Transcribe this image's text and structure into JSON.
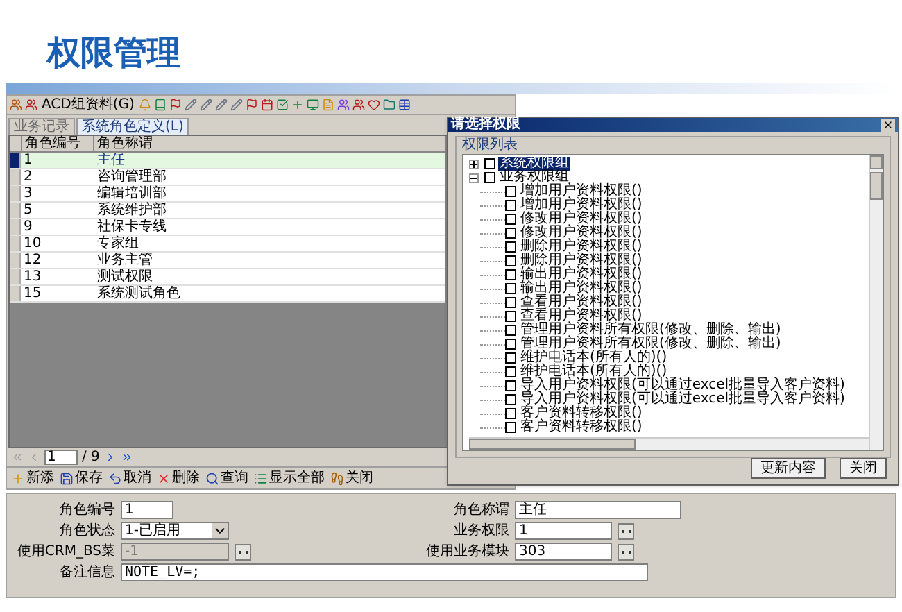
{
  "page_title": "权限管理",
  "toolbar": {
    "label_button": "ACD组资料(G)"
  },
  "tabs": [
    {
      "label": "业务记录",
      "selected": false
    },
    {
      "label": "系统角色定义(L)",
      "selected": true
    }
  ],
  "table": {
    "columns": [
      "角色编号",
      "角色称谓"
    ],
    "rows": [
      {
        "cells": [
          "1",
          "主任"
        ],
        "selected": true
      },
      {
        "cells": [
          "2",
          "咨询管理部"
        ],
        "selected": false
      },
      {
        "cells": [
          "3",
          "编辑培训部"
        ],
        "selected": false
      },
      {
        "cells": [
          "5",
          "系统维护部"
        ],
        "selected": false
      },
      {
        "cells": [
          "9",
          "社保卡专线"
        ],
        "selected": false
      },
      {
        "cells": [
          "10",
          "专家组"
        ],
        "selected": false
      },
      {
        "cells": [
          "12",
          "业务主管"
        ],
        "selected": false
      },
      {
        "cells": [
          "13",
          "测试权限"
        ],
        "selected": false
      },
      {
        "cells": [
          "15",
          "系统测试角色"
        ],
        "selected": false
      }
    ]
  },
  "pager": {
    "page": "1",
    "total": "/ 9"
  },
  "actions": [
    {
      "label": "新添",
      "kind": "add"
    },
    {
      "label": "保存",
      "kind": "save"
    },
    {
      "label": "取消",
      "kind": "undo"
    },
    {
      "label": "删除",
      "kind": "delete"
    },
    {
      "label": "查询",
      "kind": "search"
    },
    {
      "label": "显示全部",
      "kind": "all"
    },
    {
      "label": "关闭",
      "kind": "close"
    }
  ],
  "form": {
    "left": [
      {
        "label": "角色编号",
        "value": "1",
        "kind": "text",
        "disabled": false
      },
      {
        "label": "角色状态",
        "value": "1-已启用",
        "kind": "select",
        "disabled": false
      },
      {
        "label": "使用CRM_BS菜",
        "value": "-1",
        "kind": "lookup",
        "disabled": true
      }
    ],
    "right": [
      {
        "label": "角色称谓",
        "value": "主任",
        "kind": "text",
        "disabled": false
      },
      {
        "label": "业务权限",
        "value": "1",
        "kind": "lookup",
        "disabled": false
      },
      {
        "label": "使用业务模块",
        "value": "303",
        "kind": "lookup",
        "disabled": false
      }
    ],
    "note": {
      "label": "备注信息",
      "value": "NOTE_LV=;"
    }
  },
  "dialog": {
    "title": "请选择权限",
    "group": "权限列表",
    "tree": [
      {
        "label": "系统权限组",
        "checked": false,
        "expanded": false,
        "selected": true
      },
      {
        "label": "业务权限组",
        "checked": false,
        "expanded": true,
        "selected": false,
        "children": [
          {
            "label": "增加用户资料权限()",
            "checked": false,
            "selected": false
          },
          {
            "label": "增加用户资料权限()",
            "checked": false,
            "selected": false
          },
          {
            "label": "修改用户资料权限()",
            "checked": false,
            "selected": false
          },
          {
            "label": "修改用户资料权限()",
            "checked": false,
            "selected": false
          },
          {
            "label": "删除用户资料权限()",
            "checked": false,
            "selected": false
          },
          {
            "label": "删除用户资料权限()",
            "checked": false,
            "selected": false
          },
          {
            "label": "输出用户资料权限()",
            "checked": false,
            "selected": false
          },
          {
            "label": "输出用户资料权限()",
            "checked": false,
            "selected": false
          },
          {
            "label": "查看用户资料权限()",
            "checked": false,
            "selected": false
          },
          {
            "label": "查看用户资料权限()",
            "checked": false,
            "selected": false
          },
          {
            "label": "管理用户资料所有权限(修改、删除、输出)",
            "checked": false,
            "selected": false
          },
          {
            "label": "管理用户资料所有权限(修改、删除、输出)",
            "checked": false,
            "selected": false
          },
          {
            "label": "维护电话本(所有人的)()",
            "checked": false,
            "selected": false
          },
          {
            "label": "维护电话本(所有人的)()",
            "checked": false,
            "selected": false
          },
          {
            "label": "导入用户资料权限(可以通过excel批量导入客户资料)",
            "checked": false,
            "selected": false
          },
          {
            "label": "导入用户资料权限(可以通过excel批量导入客户资料)",
            "checked": false,
            "selected": false
          },
          {
            "label": "客户资料转移权限()",
            "checked": false,
            "selected": false
          },
          {
            "label": "客户资料转移权限()",
            "checked": false,
            "selected": false
          }
        ]
      }
    ],
    "buttons": [
      "更新内容",
      "关闭"
    ]
  }
}
